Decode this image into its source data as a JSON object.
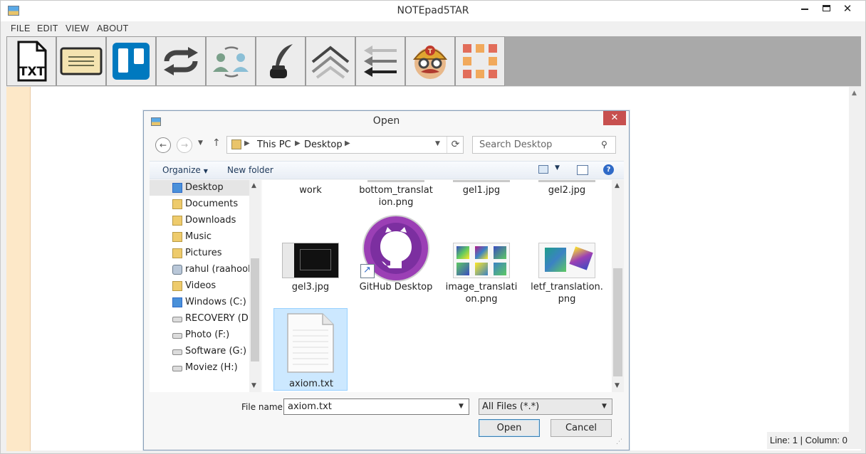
{
  "app": {
    "title": "NOTEpad5TAR",
    "menu": [
      "FILE",
      "EDIT",
      "VIEW",
      "ABOUT"
    ],
    "window_controls": {
      "minimize": "minimize-icon",
      "maximize": "maximize-icon",
      "close": "✕"
    },
    "toolbar_icons": [
      "txt-file-icon",
      "notepad-icon",
      "trello-icon",
      "repeat-icon",
      "users-sync-icon",
      "quill-pen-icon",
      "double-chevron-up-icon",
      "arrows-left-icon",
      "gravatar-mascot-icon",
      "grid-tiles-icon"
    ],
    "toolbar_text": {
      "txt": "TXT"
    },
    "status": "Line: 1 | Column: 0"
  },
  "dialog": {
    "title": "Open",
    "close_glyph": "✕",
    "nav": {
      "back_glyph": "←",
      "forward_glyph": "→",
      "up_glyph": "↑",
      "breadcrumb": [
        "This PC",
        "Desktop"
      ],
      "search_placeholder": "Search Desktop"
    },
    "commands": {
      "organize": "Organize",
      "new_folder": "New folder",
      "help": "?"
    },
    "sidebar": [
      {
        "label": "Desktop",
        "icon": "desktop-folder-icon",
        "selected": true
      },
      {
        "label": "Documents",
        "icon": "documents-folder-icon"
      },
      {
        "label": "Downloads",
        "icon": "downloads-folder-icon"
      },
      {
        "label": "Music",
        "icon": "music-folder-icon"
      },
      {
        "label": "Pictures",
        "icon": "pictures-folder-icon"
      },
      {
        "label": "rahul (raahool)",
        "icon": "user-folder-icon"
      },
      {
        "label": "Videos",
        "icon": "videos-folder-icon"
      },
      {
        "label": "Windows (C:)",
        "icon": "windows-drive-icon"
      },
      {
        "label": "RECOVERY (D:)",
        "icon": "drive-icon"
      },
      {
        "label": "Photo (F:)",
        "icon": "drive-icon"
      },
      {
        "label": "Software (G:)",
        "icon": "drive-icon"
      },
      {
        "label": "Moviez (H:)",
        "icon": "drive-icon"
      }
    ],
    "files": [
      {
        "name": "work",
        "kind": "folder"
      },
      {
        "name": "bottom_translat ion.png",
        "kind": "image"
      },
      {
        "name": "gel1.jpg",
        "kind": "image"
      },
      {
        "name": "gel2.jpg",
        "kind": "image"
      },
      {
        "name": "gel3.jpg",
        "kind": "image"
      },
      {
        "name": "GitHub Desktop",
        "kind": "shortcut"
      },
      {
        "name": "image_translati on.png",
        "kind": "image"
      },
      {
        "name": "letf_translation. png",
        "kind": "image"
      },
      {
        "name": "axiom.txt",
        "kind": "text",
        "selected": true
      }
    ],
    "filename_label": "File name:",
    "filename_value": "axiom.txt",
    "filter_value": "All Files (*.*)",
    "open_label": "Open",
    "cancel_label": "Cancel"
  }
}
